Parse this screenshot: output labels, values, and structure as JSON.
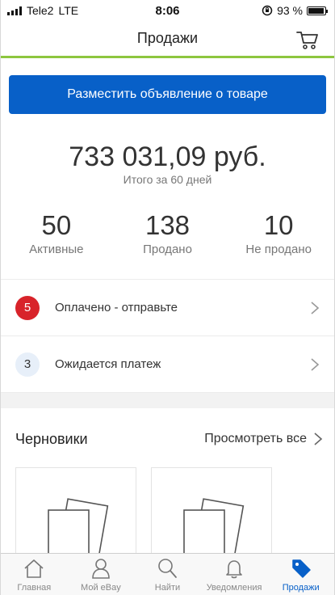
{
  "status_bar": {
    "carrier": "Tele2",
    "network": "LTE",
    "time": "8:06",
    "battery": "93 %",
    "battery_level": 0.93
  },
  "header": {
    "title": "Продажи",
    "cart_icon": "cart-icon"
  },
  "cta": {
    "label": "Разместить объявление о товаре"
  },
  "summary": {
    "amount": "733 031,09 руб.",
    "caption": "Итого за 60 дней"
  },
  "stats": [
    {
      "value": "50",
      "label": "Активные"
    },
    {
      "value": "138",
      "label": "Продано"
    },
    {
      "value": "10",
      "label": "Не продано"
    }
  ],
  "actions": [
    {
      "badge": "5",
      "label": "Оплачено - отправьте"
    },
    {
      "badge": "3",
      "label": "Ожидается платеж"
    }
  ],
  "drafts": {
    "title": "Черновики",
    "see_all": "Просмотреть все"
  },
  "tabs": [
    {
      "label": "Главная",
      "icon": "home-icon"
    },
    {
      "label": "Мой eBay",
      "icon": "profile-icon"
    },
    {
      "label": "Найти",
      "icon": "search-icon"
    },
    {
      "label": "Уведомления",
      "icon": "bell-icon"
    },
    {
      "label": "Продажи",
      "icon": "tag-icon",
      "active": true
    }
  ],
  "colors": {
    "primary_blue": "#0860c8",
    "accent_green": "#8dc63f",
    "alert_red": "#d8232a"
  }
}
